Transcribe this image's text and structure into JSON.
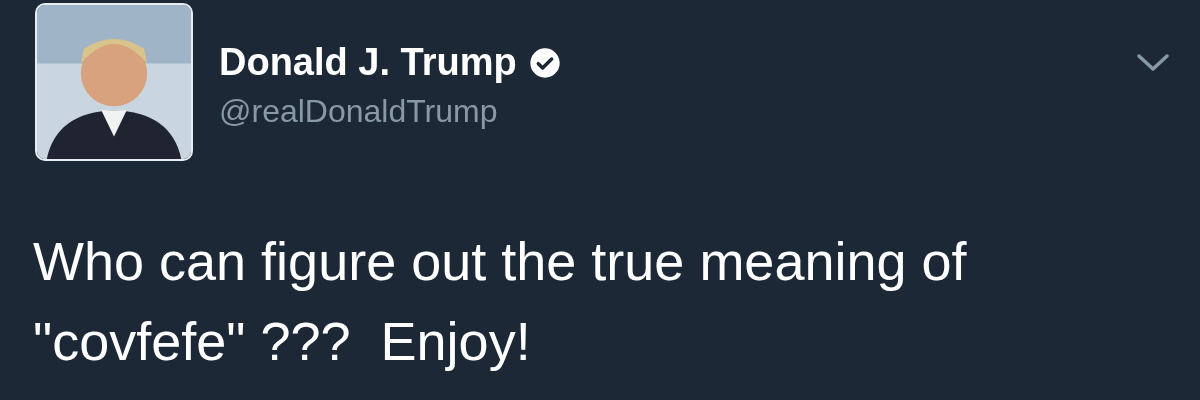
{
  "author": {
    "name": "Donald J. Trump",
    "verified": true,
    "handle": "@realDonaldTrump"
  },
  "tweet": {
    "text": "Who can figure out the true meaning of \"covfefe\" ???  Enjoy!"
  }
}
